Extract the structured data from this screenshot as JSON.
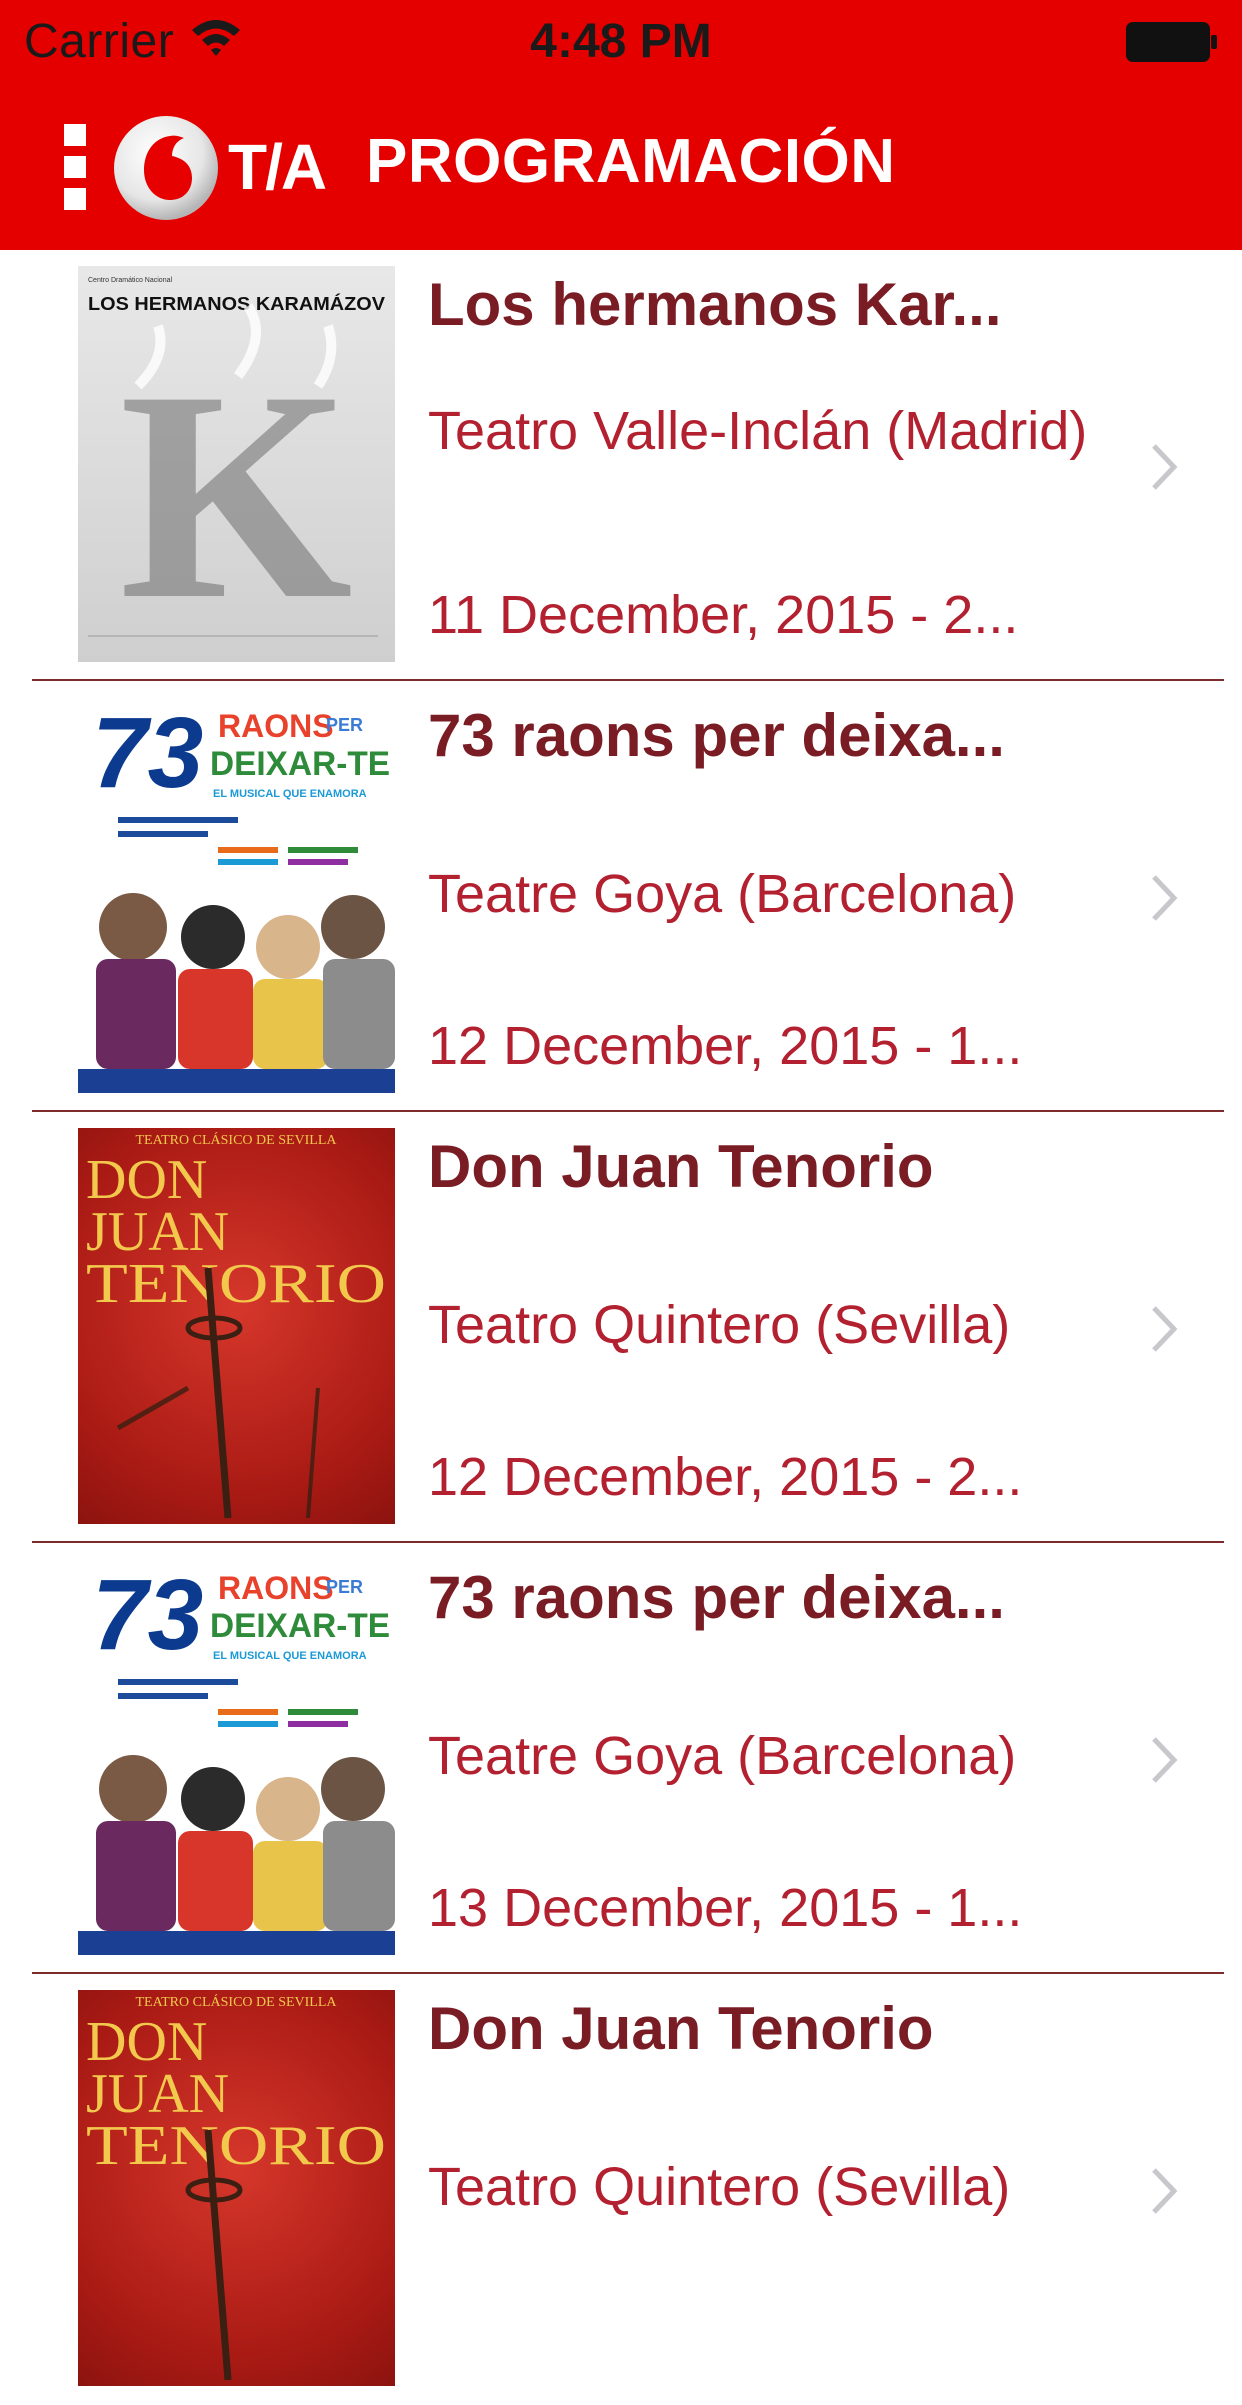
{
  "status_bar": {
    "carrier": "Carrier",
    "time": "4:48 PM"
  },
  "nav": {
    "logo_text": "T/A",
    "title": "PROGRAMACIÓN"
  },
  "colors": {
    "brand_red": "#e50000",
    "title_text": "#7a1c24",
    "detail_text": "#b3202f",
    "separator": "#7d2a2a"
  },
  "events": [
    {
      "title": "Los hermanos Kar...",
      "venue": "Teatro Valle-Inclán (Madrid)",
      "date": "11 December, 2015 - 2...",
      "poster": {
        "org": "Centro Dramático Nacional",
        "heading": "LOS HERMANOS KARAMÁZOV",
        "letter": "K"
      }
    },
    {
      "title": "73 raons per deixa...",
      "venue": "Teatre Goya (Barcelona)",
      "date": "12 December, 2015 - 1...",
      "poster": {
        "number": "73",
        "word1": "RAONS",
        "word_per": "PER",
        "word2": "DEIXAR-TE",
        "tagline": "EL MUSICAL QUE ENAMORA"
      }
    },
    {
      "title": "Don Juan Tenorio",
      "venue": "Teatro Quintero (Sevilla)",
      "date": "12 December, 2015 - 2...",
      "poster": {
        "company": "TEATRO CLÁSICO DE SEVILLA",
        "line1": "DON",
        "line2": "JUAN",
        "line3": "TENORIO"
      }
    },
    {
      "title": "73 raons per deixa...",
      "venue": "Teatre Goya (Barcelona)",
      "date": "13 December, 2015 - 1...",
      "poster": {
        "number": "73",
        "word1": "RAONS",
        "word_per": "PER",
        "word2": "DEIXAR-TE",
        "tagline": "EL MUSICAL QUE ENAMORA"
      }
    },
    {
      "title": "Don Juan Tenorio",
      "venue": "Teatro Quintero (Sevilla)",
      "date": "",
      "poster": {
        "company": "TEATRO CLÁSICO DE SEVILLA",
        "line1": "DON",
        "line2": "JUAN",
        "line3": "TENORIO"
      }
    }
  ]
}
